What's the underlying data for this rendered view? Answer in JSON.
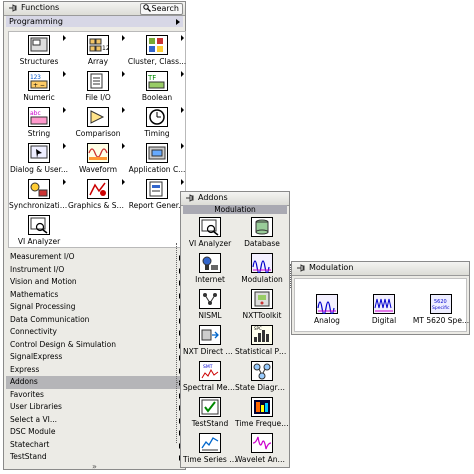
{
  "functions_palette": {
    "title": "Functions",
    "search_label": "Search",
    "category_header": "Programming",
    "icons": [
      {
        "label": "Structures",
        "icon": "structures-icon",
        "has_arrow": true
      },
      {
        "label": "Array",
        "icon": "array-icon",
        "has_arrow": true
      },
      {
        "label": "Cluster, Class...",
        "icon": "cluster-icon",
        "has_arrow": true
      },
      {
        "label": "Numeric",
        "icon": "numeric-icon",
        "has_arrow": true
      },
      {
        "label": "File I/O",
        "icon": "file-io-icon",
        "has_arrow": true
      },
      {
        "label": "Boolean",
        "icon": "boolean-icon",
        "has_arrow": true
      },
      {
        "label": "String",
        "icon": "string-icon",
        "has_arrow": true
      },
      {
        "label": "Comparison",
        "icon": "comparison-icon",
        "has_arrow": true
      },
      {
        "label": "Timing",
        "icon": "timing-icon",
        "has_arrow": true
      },
      {
        "label": "Dialog & User...",
        "icon": "dialog-icon",
        "has_arrow": true
      },
      {
        "label": "Waveform",
        "icon": "waveform-icon",
        "has_arrow": true
      },
      {
        "label": "Application C...",
        "icon": "application-control-icon",
        "has_arrow": true
      },
      {
        "label": "Synchronization",
        "icon": "synchronization-icon",
        "has_arrow": true
      },
      {
        "label": "Graphics & So...",
        "icon": "graphics-sound-icon",
        "has_arrow": true
      },
      {
        "label": "Report Gener...",
        "icon": "report-generation-icon",
        "has_arrow": true
      },
      {
        "label": "VI Analyzer",
        "icon": "vi-analyzer-icon",
        "has_arrow": false
      }
    ],
    "categories": [
      {
        "label": "Measurement I/O",
        "selected": false
      },
      {
        "label": "Instrument I/O",
        "selected": false
      },
      {
        "label": "Vision and Motion",
        "selected": false
      },
      {
        "label": "Mathematics",
        "selected": false
      },
      {
        "label": "Signal Processing",
        "selected": false
      },
      {
        "label": "Data Communication",
        "selected": false
      },
      {
        "label": "Connectivity",
        "selected": false
      },
      {
        "label": "Control Design & Simulation",
        "selected": false
      },
      {
        "label": "SignalExpress",
        "selected": false
      },
      {
        "label": "Express",
        "selected": false
      },
      {
        "label": "Addons",
        "selected": true
      },
      {
        "label": "Favorites",
        "selected": false
      },
      {
        "label": "User Libraries",
        "selected": false
      },
      {
        "label": "Select a VI...",
        "selected": false
      },
      {
        "label": "DSC Module",
        "selected": false
      },
      {
        "label": "Statechart",
        "selected": false
      },
      {
        "label": "TestStand",
        "selected": false
      }
    ],
    "scroll_glyph": "»"
  },
  "addons_palette": {
    "title": "Addons",
    "header": "Modulation",
    "icons": [
      {
        "label": "VI Analyzer",
        "icon": "vi-analyzer-icon"
      },
      {
        "label": "Database",
        "icon": "database-icon"
      },
      {
        "label": "Internet",
        "icon": "internet-icon"
      },
      {
        "label": "Modulation",
        "icon": "modulation-icon"
      },
      {
        "label": "NISML",
        "icon": "nisml-icon"
      },
      {
        "label": "NXTToolkit",
        "icon": "nxt-toolkit-icon"
      },
      {
        "label": "NXT Direct Co...",
        "icon": "nxt-direct-icon"
      },
      {
        "label": "Statistical Pro...",
        "icon": "statistical-icon"
      },
      {
        "label": "Spectral Mea...",
        "icon": "spectral-icon"
      },
      {
        "label": "State Diagra...",
        "icon": "state-diagram-icon"
      },
      {
        "label": "TestStand",
        "icon": "teststand-icon"
      },
      {
        "label": "Time Frequen...",
        "icon": "time-frequency-icon"
      },
      {
        "label": "Time Series A...",
        "icon": "time-series-icon"
      },
      {
        "label": "Wavelet Anal...",
        "icon": "wavelet-icon"
      }
    ]
  },
  "modulation_palette": {
    "title": "Modulation",
    "icons": [
      {
        "label": "Analog",
        "icon": "analog-modulation-icon"
      },
      {
        "label": "Digital",
        "icon": "digital-modulation-icon"
      },
      {
        "label": "MT 5620 Spe...",
        "icon": "mt5620-icon",
        "text": "5620 Specific"
      }
    ]
  },
  "colors": {
    "palette_bg": "#ecebe6",
    "selected_row": "#b5b5b8",
    "header_bg": "#d7d7e6"
  }
}
